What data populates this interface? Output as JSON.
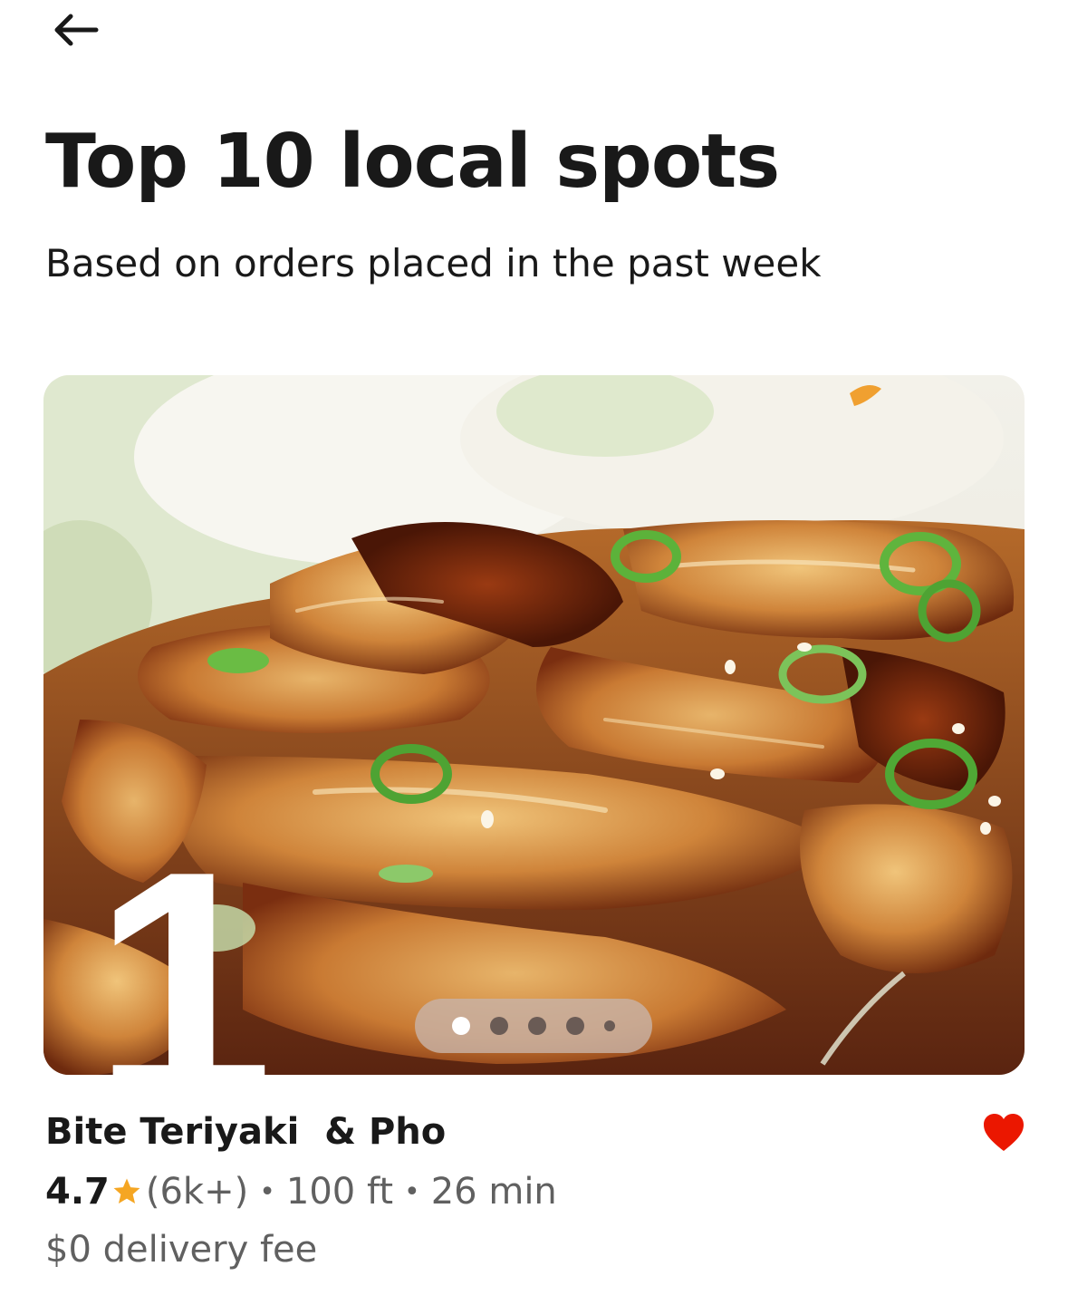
{
  "nav": {
    "back_icon": "arrow-left-icon"
  },
  "header": {
    "title": "Top 10 local spots",
    "subtitle": "Based on orders placed in the past week"
  },
  "store": {
    "rank": "1",
    "name": "Bite Teriyaki  & Pho",
    "rating": "4.7",
    "rating_count": "(6k+)",
    "distance": "100 ft",
    "eta": "26 min",
    "separator": "•",
    "delivery_fee": "$0 delivery fee",
    "favorited": true,
    "image_description_icon": "teriyaki-chicken-photo",
    "carousel": {
      "total_dots": 5,
      "active_index": 0
    }
  },
  "colors": {
    "text": "#191919",
    "secondary_text": "#606060",
    "heart": "#eb1700",
    "star": "#f5a623",
    "background": "#ffffff"
  }
}
